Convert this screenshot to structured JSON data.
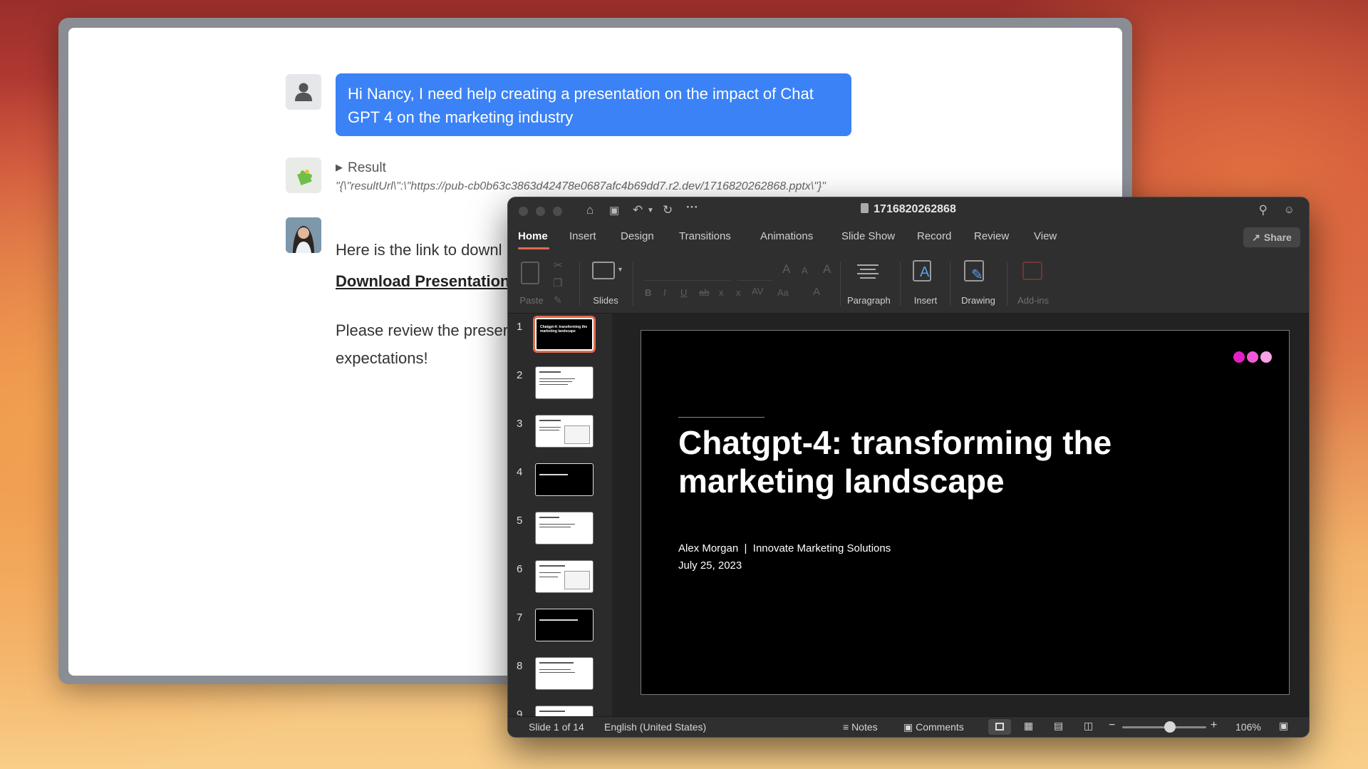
{
  "chat": {
    "user_message": "Hi Nancy, I need help creating a presentation on the impact of Chat GPT 4 on the marketing industry",
    "result_label": "Result",
    "result_json": "\"{\\\"resultUrl\\\":\\\"https://pub-cb0b63c3863d42478e0687afc4b69dd7.r2.dev/1716820262868.pptx\\\"}\"",
    "link_intro": "Here is the link to downl",
    "download_link": "Download Presentation",
    "review_text": "Please review the preser additional details you wo expectations!"
  },
  "ppt": {
    "doc_title": "1716820262868",
    "tabs": [
      "Home",
      "Insert",
      "Design",
      "Transitions",
      "Animations",
      "Slide Show",
      "Record",
      "Review",
      "View"
    ],
    "share_label": "Share",
    "ribbon": {
      "paste": "Paste",
      "slides": "Slides",
      "paragraph": "Paragraph",
      "insert": "Insert",
      "drawing": "Drawing",
      "addins": "Add-ins"
    },
    "thumb_numbers": [
      "1",
      "2",
      "3",
      "4",
      "5",
      "6",
      "7",
      "8",
      "9"
    ],
    "thumb_1_title": "Chatgpt-4: transforming the marketing landscape",
    "slide": {
      "title": "Chatgpt-4: transforming the marketing landscape",
      "author": "Alex Morgan  |  Innovate Marketing Solutions",
      "date": "July 25, 2023",
      "dot_colors": [
        "#e41fc8",
        "#f05ad6",
        "#f6a2e6"
      ]
    },
    "status": {
      "slide_counter": "Slide 1 of 14",
      "language": "English (United States)",
      "notes": "Notes",
      "comments": "Comments",
      "zoom": "106%"
    }
  },
  "colors": {
    "accent": "#e06b4f",
    "bubble": "#3b82f6"
  }
}
